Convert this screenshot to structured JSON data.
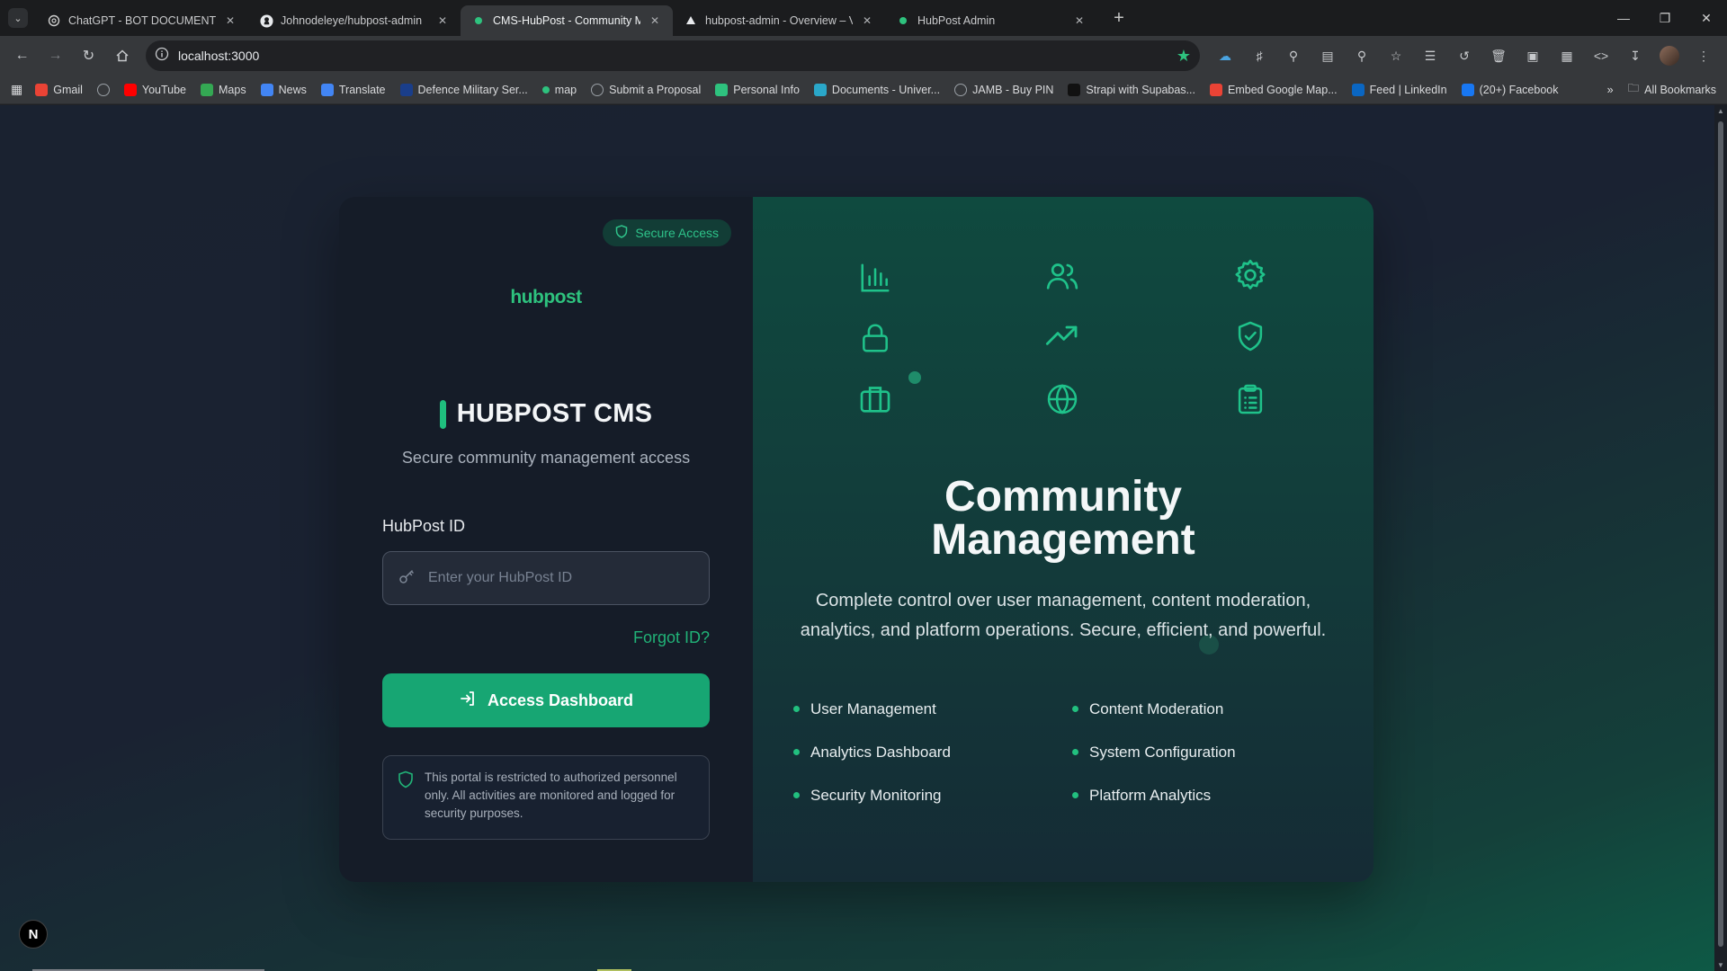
{
  "browser": {
    "tabs": [
      {
        "title": "ChatGPT - BOT DOCUMENT",
        "icon": "chatgpt-icon",
        "active": false
      },
      {
        "title": "Johnodeleye/hubpost-admin",
        "icon": "github-icon",
        "active": false
      },
      {
        "title": "CMS-HubPost - Community Ma",
        "icon": "green-dot-icon",
        "active": true
      },
      {
        "title": "hubpost-admin - Overview – Ve",
        "icon": "vercel-icon",
        "active": false
      },
      {
        "title": "HubPost Admin",
        "icon": "green-dot-icon",
        "active": false
      }
    ],
    "url": "localhost:3000",
    "bookmarks": [
      {
        "label": "Gmail",
        "icon": "gmail-icon",
        "color": "#ea4335"
      },
      {
        "label": "",
        "icon": "globe-icon",
        "color": "#9aa0a6"
      },
      {
        "label": "YouTube",
        "icon": "youtube-icon",
        "color": "#ff0000"
      },
      {
        "label": "Maps",
        "icon": "maps-icon",
        "color": "#34a853"
      },
      {
        "label": "News",
        "icon": "news-icon",
        "color": "#4285f4"
      },
      {
        "label": "Translate",
        "icon": "translate-icon",
        "color": "#4285f4"
      },
      {
        "label": "Defence Military Ser...",
        "icon": "defence-icon",
        "color": "#1a3e8a"
      },
      {
        "label": "map",
        "icon": "green-dot-icon",
        "color": "#2ec27e"
      },
      {
        "label": "Submit a Proposal",
        "icon": "globe-icon",
        "color": "#9aa0a6"
      },
      {
        "label": "Personal Info",
        "icon": "personal-info-icon",
        "color": "#2ec27e"
      },
      {
        "label": "Documents - Univer...",
        "icon": "documents-icon",
        "color": "#2aa7c9"
      },
      {
        "label": "JAMB - Buy PIN",
        "icon": "globe-icon",
        "color": "#9aa0a6"
      },
      {
        "label": "Strapi with Supabas...",
        "icon": "strapi-icon",
        "color": "#111111"
      },
      {
        "label": "Embed Google Map...",
        "icon": "map-pin-icon",
        "color": "#ea4335"
      },
      {
        "label": "Feed | LinkedIn",
        "icon": "linkedin-icon",
        "color": "#0a66c2"
      },
      {
        "label": "(20+) Facebook",
        "icon": "facebook-icon",
        "color": "#1877f2"
      }
    ],
    "all_bookmarks": "All Bookmarks"
  },
  "login": {
    "badge": "Secure Access",
    "logo": "hubpost",
    "title": "HUBPOST CMS",
    "subtitle": "Secure community management access",
    "field_label": "HubPost ID",
    "field_placeholder": "Enter your HubPost ID",
    "field_value": "",
    "forgot": "Forgot ID?",
    "submit": "Access Dashboard",
    "notice": "This portal is restricted to authorized personnel only. All activities are monitored and logged for security purposes."
  },
  "hero": {
    "icons": [
      "bar-chart-icon",
      "users-icon",
      "settings-gear-icon",
      "lock-icon",
      "trending-up-icon",
      "shield-check-icon",
      "briefcase-icon",
      "globe-icon",
      "clipboard-list-icon"
    ],
    "title_line1": "Community",
    "title_line2": "Management",
    "description": "Complete control over user management, content moderation, analytics, and platform operations. Secure, efficient, and powerful.",
    "features": [
      "User Management",
      "Content Moderation",
      "Analytics Dashboard",
      "System Configuration",
      "Security Monitoring",
      "Platform Analytics"
    ]
  },
  "colors": {
    "accent": "#17a673",
    "accent_text": "#21b277",
    "left_panel": "#151c28",
    "right_panel": "#0f4a3f"
  },
  "dev_badge": "N"
}
